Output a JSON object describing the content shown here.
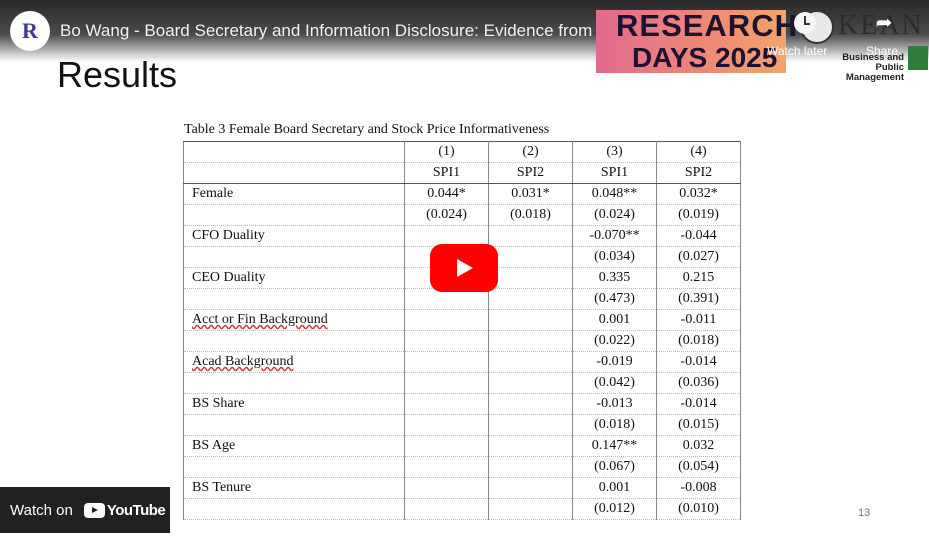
{
  "video": {
    "title": "Bo Wang - Board Secretary and Information Disclosure: Evidence from Chinese listed ...",
    "watch_later": "Watch later",
    "share": "Share",
    "watch_on": "Watch on",
    "youtube": "YouTube"
  },
  "channel": {
    "avatar_letter": "R"
  },
  "banner": {
    "line1": "RESEARCH",
    "line2": "DAYS 2025"
  },
  "kean": {
    "name": "KEAN",
    "sub1": "Business and",
    "sub2": "Public Management"
  },
  "slide": {
    "title": "Results",
    "page_number": "13",
    "table_caption": "Table 3 Female Board Secretary and Stock Price Informativeness",
    "header_cols": [
      "(1)",
      "(2)",
      "(3)",
      "(4)"
    ],
    "header_vars": [
      "SPI1",
      "SPI2",
      "SPI1",
      "SPI2"
    ],
    "rows": [
      {
        "label": "Female",
        "values": [
          "0.044*",
          "0.031*",
          "0.048**",
          "0.032*"
        ],
        "se": [
          "(0.024)",
          "(0.018)",
          "(0.024)",
          "(0.019)"
        ]
      },
      {
        "label": "CFO Duality",
        "values": [
          "",
          "",
          "-0.070**",
          "-0.044"
        ],
        "se": [
          "",
          "",
          "(0.034)",
          "(0.027)"
        ]
      },
      {
        "label": "CEO Duality",
        "values": [
          "",
          "",
          "0.335",
          "0.215"
        ],
        "se": [
          "",
          "",
          "(0.473)",
          "(0.391)"
        ]
      },
      {
        "label": "Acct or Fin Background",
        "values": [
          "",
          "",
          "0.001",
          "-0.011"
        ],
        "se": [
          "",
          "",
          "(0.022)",
          "(0.018)"
        ]
      },
      {
        "label": "Acad Background",
        "values": [
          "",
          "",
          "-0.019",
          "-0.014"
        ],
        "se": [
          "",
          "",
          "(0.042)",
          "(0.036)"
        ]
      },
      {
        "label": "BS Share",
        "values": [
          "",
          "",
          "-0.013",
          "-0.014"
        ],
        "se": [
          "",
          "",
          "(0.018)",
          "(0.015)"
        ]
      },
      {
        "label": "BS Age",
        "values": [
          "",
          "",
          "0.147**",
          "0.032"
        ],
        "se": [
          "",
          "",
          "(0.067)",
          "(0.054)"
        ]
      },
      {
        "label": "BS Tenure",
        "values": [
          "",
          "",
          "0.001",
          "-0.008"
        ],
        "se": [
          "",
          "",
          "(0.012)",
          "(0.010)"
        ]
      }
    ]
  }
}
